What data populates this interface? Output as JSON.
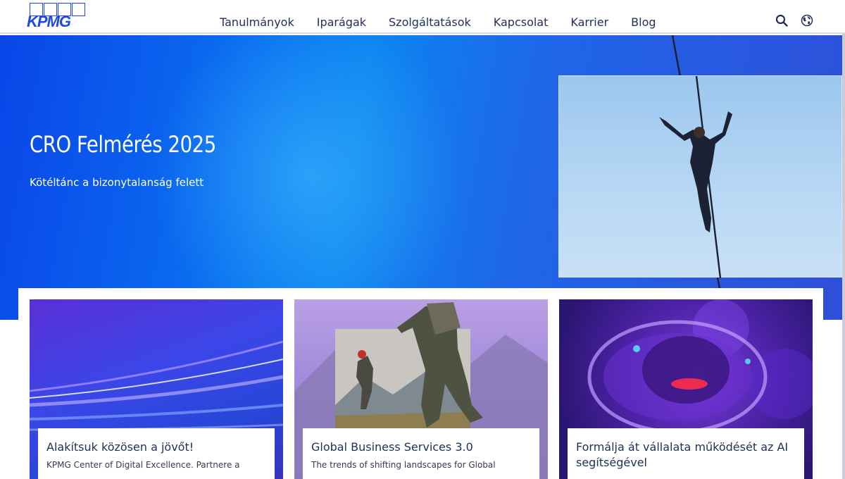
{
  "header": {
    "logo_text": "KPMG",
    "nav": [
      "Tanulmányok",
      "Iparágak",
      "Szolgáltatások",
      "Kapcsolat",
      "Karrier",
      "Blog"
    ],
    "icons": [
      "search-icon",
      "globe-icon"
    ]
  },
  "hero": {
    "title": "CRO Felmérés 2025",
    "subtitle": "Kötéltánc a bizonytalanság felett"
  },
  "cards": [
    {
      "title": "Alakítsuk közösen a jövőt!",
      "desc": "KPMG Center of Digital Excellence. Partnere a"
    },
    {
      "title": "Global Business Services 3.0",
      "desc": "The trends of shifting landscapes for Global"
    },
    {
      "title": "Formálja át vállalata működését az AI segítségével",
      "desc": ""
    }
  ],
  "colors": {
    "brand": "#1e49e2",
    "nav_text": "#1e2f5c",
    "hero_blue": "#0a6ef0"
  }
}
